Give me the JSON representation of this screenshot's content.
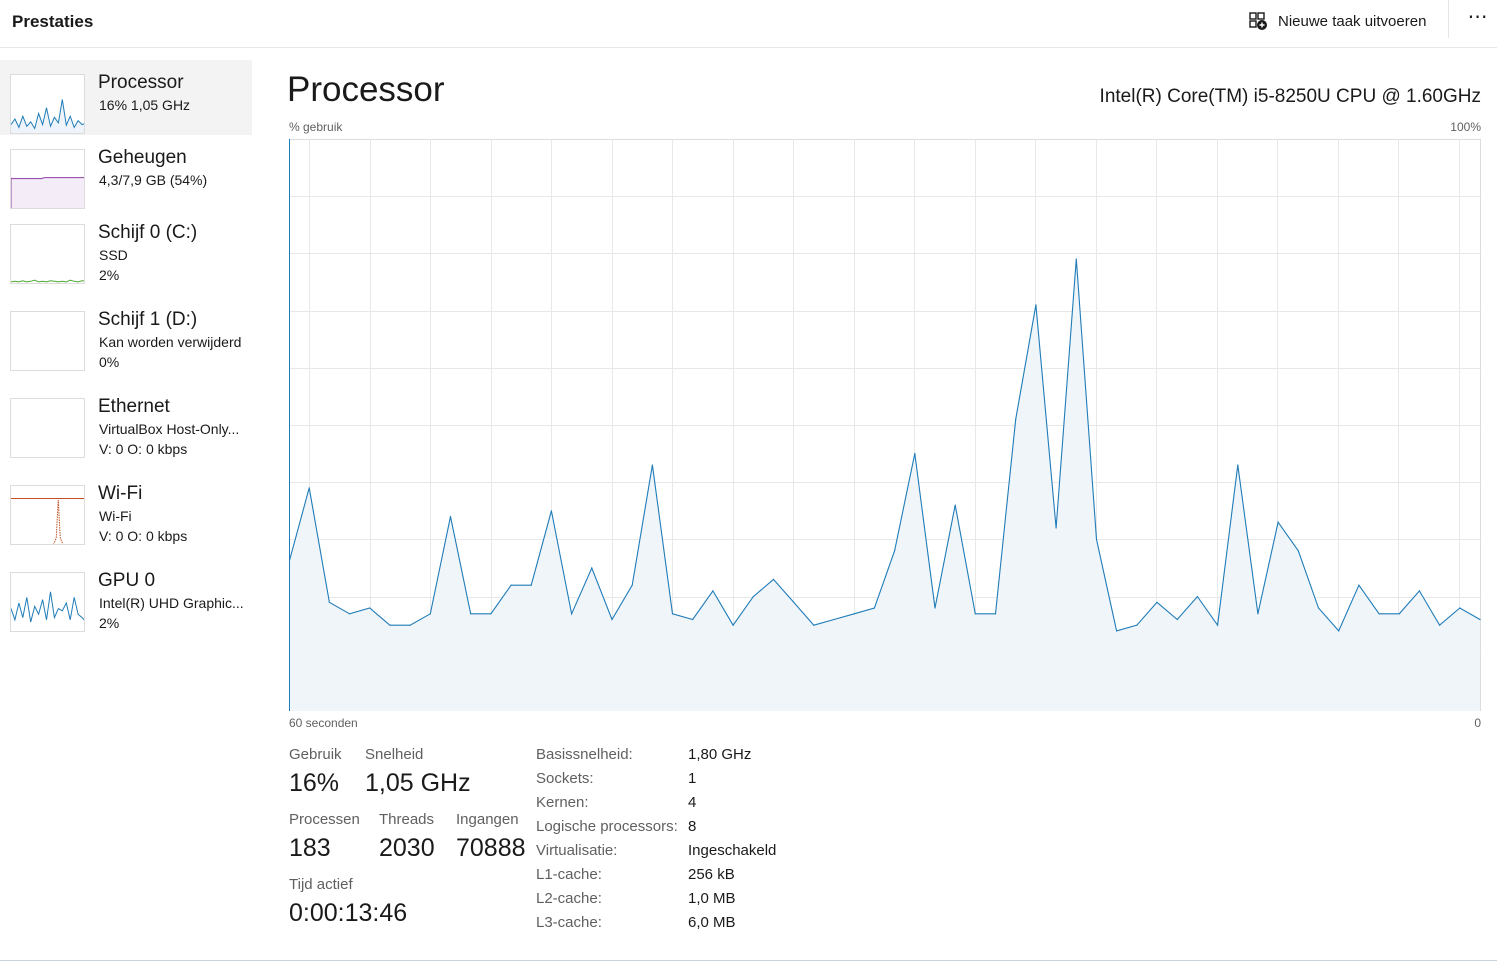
{
  "header": {
    "title": "Prestaties",
    "run_task_label": "Nieuwe taak uitvoeren",
    "more_label": "⋯"
  },
  "sidebar": {
    "items": [
      {
        "name": "Processor",
        "sub1": "16%  1,05 GHz",
        "sub2": "",
        "color": "#1f7cb8"
      },
      {
        "name": "Geheugen",
        "sub1": "4,3/7,9 GB (54%)",
        "sub2": "",
        "color": "#8e3fa8"
      },
      {
        "name": "Schijf 0 (C:)",
        "sub1": "SSD",
        "sub2": "2%",
        "color": "#4ca832"
      },
      {
        "name": "Schijf 1 (D:)",
        "sub1": "Kan worden verwijderd",
        "sub2": "0%",
        "color": "#4ca832"
      },
      {
        "name": "Ethernet",
        "sub1": "VirtualBox Host-Only...",
        "sub2": "V: 0 O: 0 kbps",
        "color": "#a8501f"
      },
      {
        "name": "Wi-Fi",
        "sub1": "Wi-Fi",
        "sub2": "V: 0 O: 0 kbps",
        "color": "#c0501f"
      },
      {
        "name": "GPU 0",
        "sub1": "Intel(R) UHD Graphic...",
        "sub2": "2%",
        "color": "#1f7cb8"
      }
    ]
  },
  "main": {
    "title": "Processor",
    "cpu_name": "Intel(R) Core(TM) i5-8250U CPU @ 1.60GHz",
    "y_axis_label": "% gebruik",
    "y_axis_max": "100%",
    "x_axis_left": "60 seconden",
    "x_axis_right": "0"
  },
  "chart_data": {
    "type": "area",
    "ylim": [
      0,
      100
    ],
    "x_unit": "seconds ago",
    "color": "#1f7cb8",
    "fill": "#f0f5fa",
    "values": [
      26,
      39,
      19,
      17,
      18,
      15,
      15,
      17,
      34,
      17,
      17,
      22,
      22,
      35,
      17,
      25,
      16,
      22,
      43,
      17,
      16,
      21,
      15,
      20,
      23,
      19,
      15,
      16,
      17,
      18,
      28,
      45,
      18,
      36,
      17,
      17,
      51,
      71,
      32,
      79,
      30,
      14,
      15,
      19,
      16,
      20,
      15,
      43,
      17,
      33,
      28,
      18,
      14,
      22,
      17,
      17,
      21,
      15,
      18,
      16
    ]
  },
  "thumbs": {
    "processor": [
      15,
      25,
      10,
      30,
      12,
      20,
      8,
      35,
      15,
      45,
      12,
      28,
      18,
      60,
      14,
      30,
      10,
      22,
      15,
      18
    ],
    "memory_level": 54,
    "disk0": [
      2,
      3,
      2,
      4,
      2,
      3,
      5,
      2,
      3,
      2,
      4,
      3,
      2,
      3,
      2,
      5,
      3,
      2,
      4,
      3
    ],
    "gpu": [
      20,
      10,
      25,
      12,
      30,
      8,
      22,
      15,
      28,
      10,
      35,
      12,
      20,
      18,
      25,
      10,
      30,
      15,
      12,
      8
    ],
    "wifi_spike_position": 0.63
  },
  "stats": {
    "gebruik_label": "Gebruik",
    "gebruik_value": "16%",
    "snelheid_label": "Snelheid",
    "snelheid_value": "1,05 GHz",
    "processen_label": "Processen",
    "processen_value": "183",
    "threads_label": "Threads",
    "threads_value": "2030",
    "ingangen_label": "Ingangen",
    "ingangen_value": "70888",
    "tijd_label": "Tijd actief",
    "tijd_value": "0:00:13:46"
  },
  "specs": [
    {
      "label": "Basissnelheid:",
      "value": "1,80 GHz"
    },
    {
      "label": "Sockets:",
      "value": "1"
    },
    {
      "label": "Kernen:",
      "value": "4"
    },
    {
      "label": "Logische processors:",
      "value": "8"
    },
    {
      "label": "Virtualisatie:",
      "value": "Ingeschakeld"
    },
    {
      "label": "L1-cache:",
      "value": "256 kB"
    },
    {
      "label": "L2-cache:",
      "value": "1,0 MB"
    },
    {
      "label": "L3-cache:",
      "value": "6,0 MB"
    }
  ]
}
